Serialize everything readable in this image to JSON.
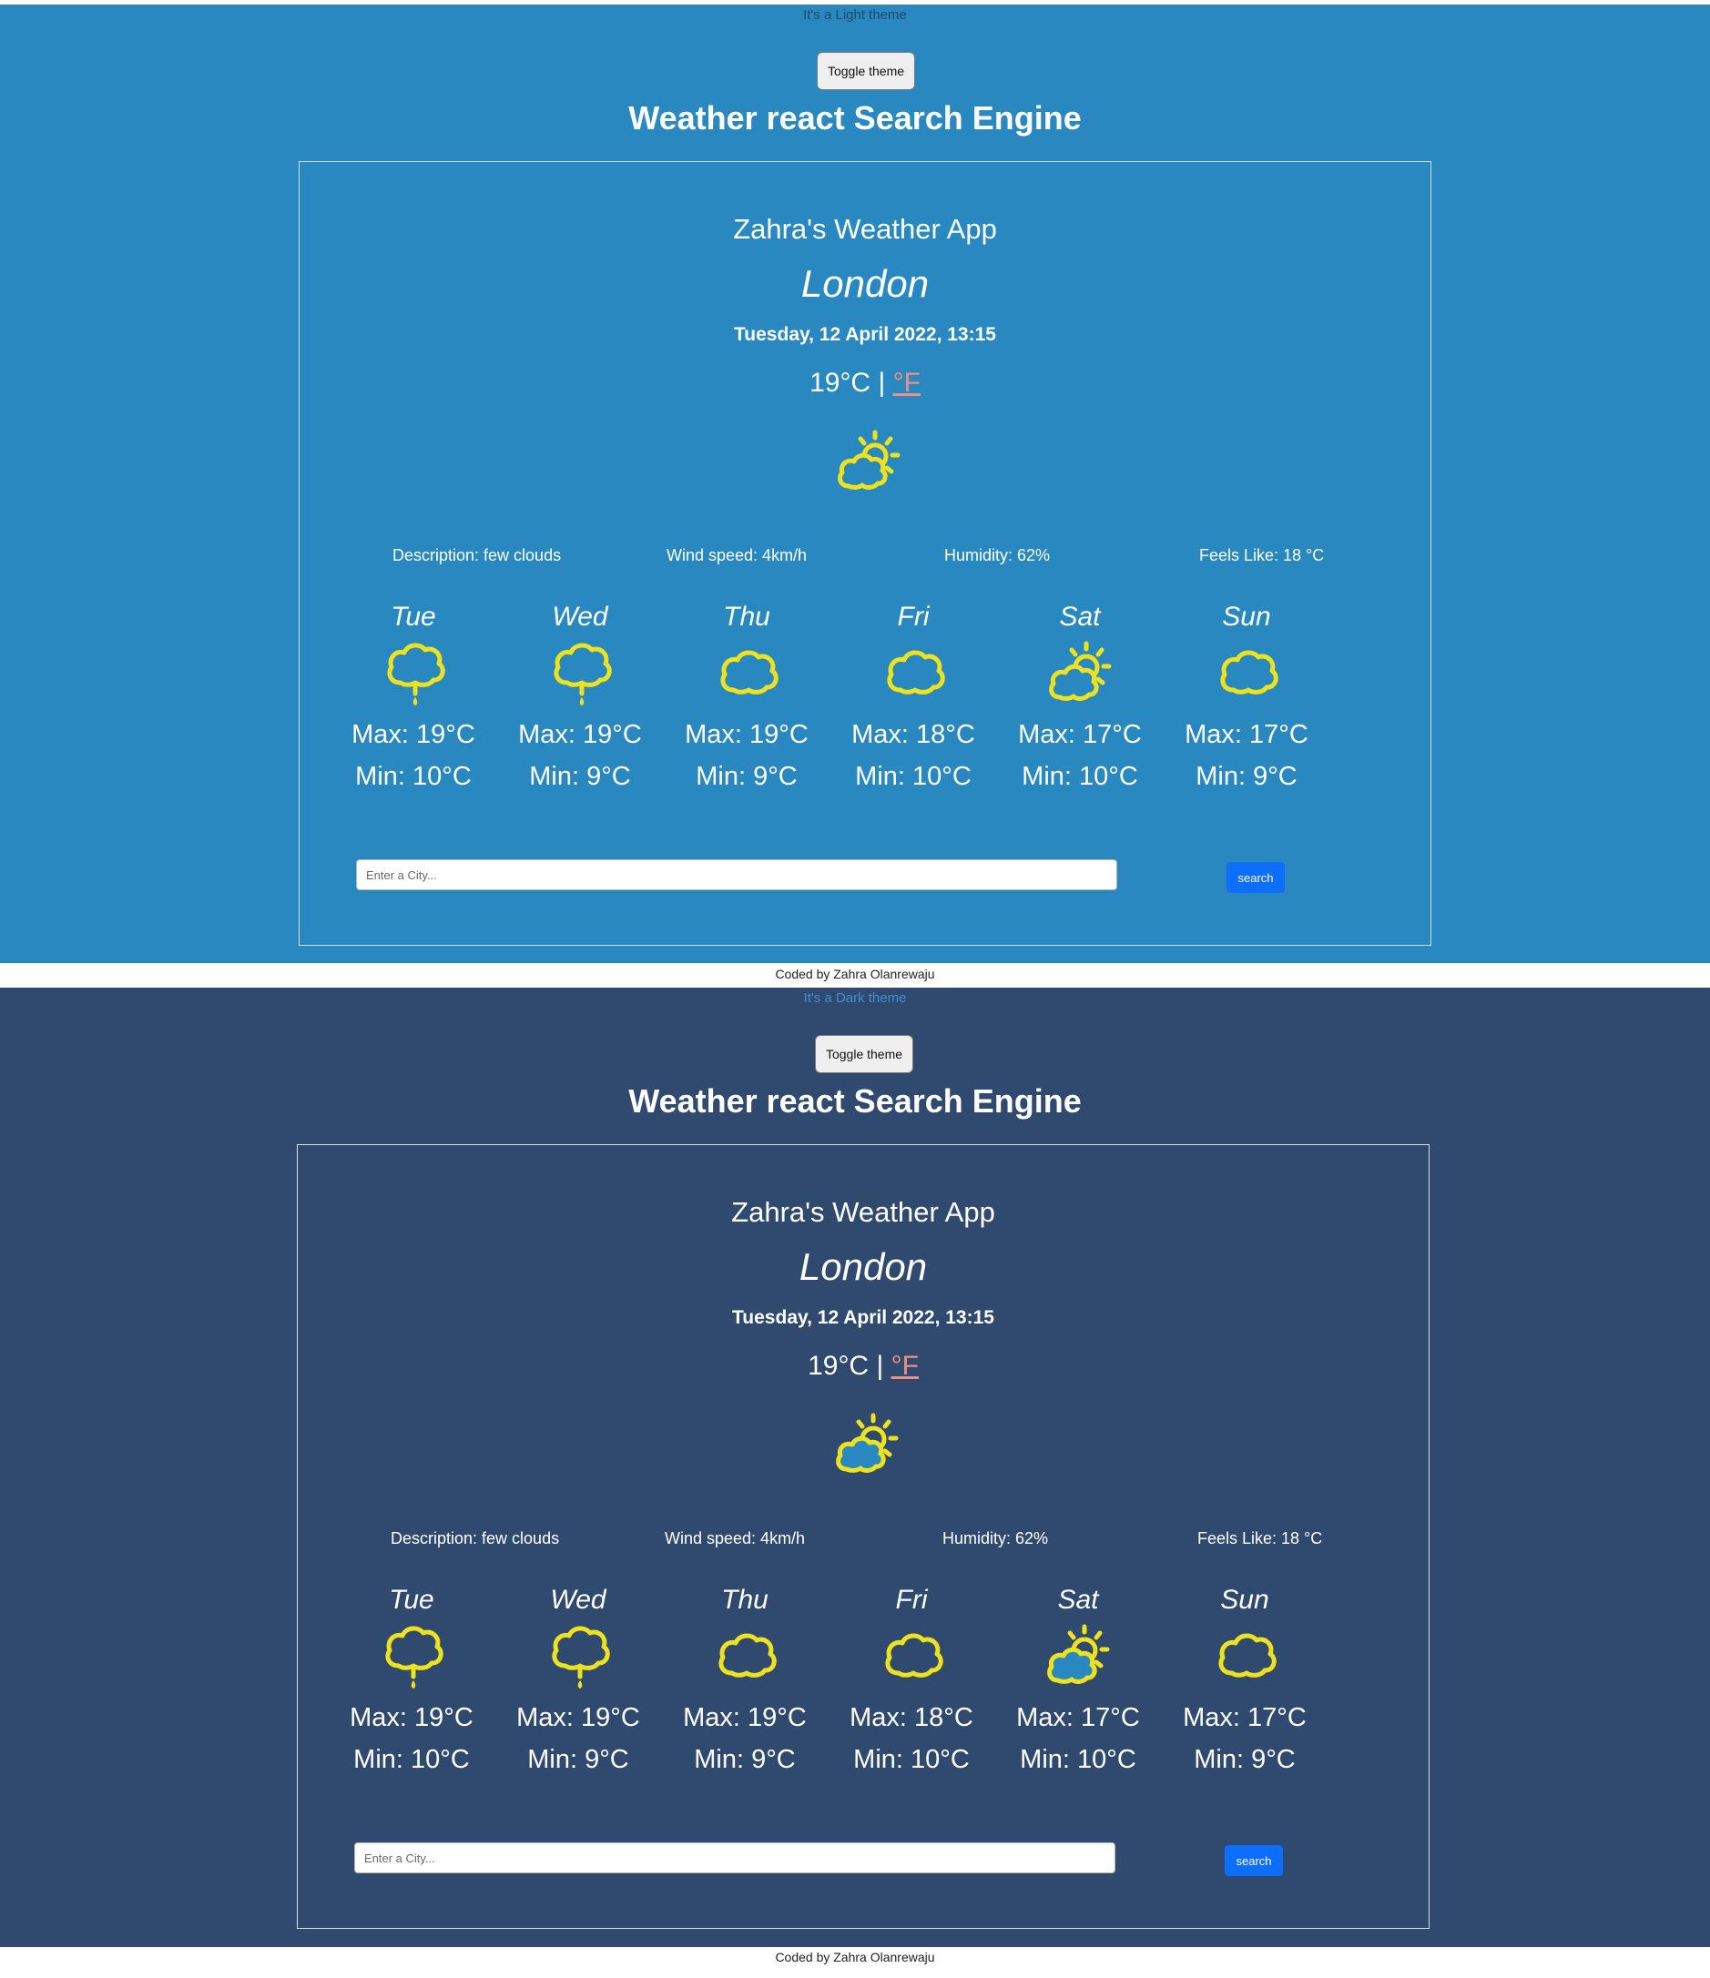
{
  "colors": {
    "light_background": "#2988c0",
    "dark_background": "#304a6f",
    "icon_yellow": "#eee21f",
    "unit_link": "#ef8f86",
    "search_button": "#0d6efd"
  },
  "themes": [
    {
      "theme_label": "It's a Light theme",
      "toggle_label": "Toggle theme",
      "heading": "Weather react Search Engine",
      "app_title": "Zahra's Weather App",
      "city": "London",
      "date_time": "Tuesday, 12 April 2022, 13:15",
      "temperature": "19",
      "unit_celsius": "°C",
      "unit_separator": "|",
      "unit_fahrenheit": "°F",
      "main_icon": "partly-cloudy-day-icon",
      "details": {
        "description": "Description: few clouds",
        "wind": "Wind speed: 4km/h",
        "humidity": "Humidity: 62%",
        "feels_like": "Feels Like: 18 °C"
      },
      "forecast": [
        {
          "day": "Tue",
          "icon": "rain-cloud-icon",
          "max": "Max: 19°C",
          "min": "Min: 10°C"
        },
        {
          "day": "Wed",
          "icon": "rain-cloud-icon",
          "max": "Max: 19°C",
          "min": "Min: 9°C"
        },
        {
          "day": "Thu",
          "icon": "cloud-icon",
          "max": "Max: 19°C",
          "min": "Min: 9°C"
        },
        {
          "day": "Fri",
          "icon": "cloud-icon",
          "max": "Max: 18°C",
          "min": "Min: 10°C"
        },
        {
          "day": "Sat",
          "icon": "partly-cloudy-day-icon",
          "max": "Max: 17°C",
          "min": "Min: 10°C"
        },
        {
          "day": "Sun",
          "icon": "cloud-icon",
          "max": "Max: 17°C",
          "min": "Min: 9°C"
        }
      ],
      "search_placeholder": "Enter a City...",
      "search_value": "",
      "search_label": "search",
      "footer": "Coded by Zahra Olanrewaju"
    },
    {
      "theme_label": "It's a Dark theme",
      "toggle_label": "Toggle theme",
      "heading": "Weather react Search Engine",
      "app_title": "Zahra's Weather App",
      "city": "London",
      "date_time": "Tuesday, 12 April 2022, 13:15",
      "temperature": "19",
      "unit_celsius": "°C",
      "unit_separator": "|",
      "unit_fahrenheit": "°F",
      "main_icon": "partly-cloudy-day-icon",
      "details": {
        "description": "Description: few clouds",
        "wind": "Wind speed: 4km/h",
        "humidity": "Humidity: 62%",
        "feels_like": "Feels Like: 18 °C"
      },
      "forecast": [
        {
          "day": "Tue",
          "icon": "rain-cloud-icon",
          "max": "Max: 19°C",
          "min": "Min: 10°C"
        },
        {
          "day": "Wed",
          "icon": "rain-cloud-icon",
          "max": "Max: 19°C",
          "min": "Min: 9°C"
        },
        {
          "day": "Thu",
          "icon": "cloud-icon",
          "max": "Max: 19°C",
          "min": "Min: 9°C"
        },
        {
          "day": "Fri",
          "icon": "cloud-icon",
          "max": "Max: 18°C",
          "min": "Min: 10°C"
        },
        {
          "day": "Sat",
          "icon": "partly-cloudy-day-icon",
          "max": "Max: 17°C",
          "min": "Min: 10°C"
        },
        {
          "day": "Sun",
          "icon": "cloud-icon",
          "max": "Max: 17°C",
          "min": "Min: 9°C"
        }
      ],
      "search_placeholder": "Enter a City...",
      "search_value": "",
      "search_label": "search",
      "footer": "Coded by Zahra Olanrewaju"
    }
  ]
}
